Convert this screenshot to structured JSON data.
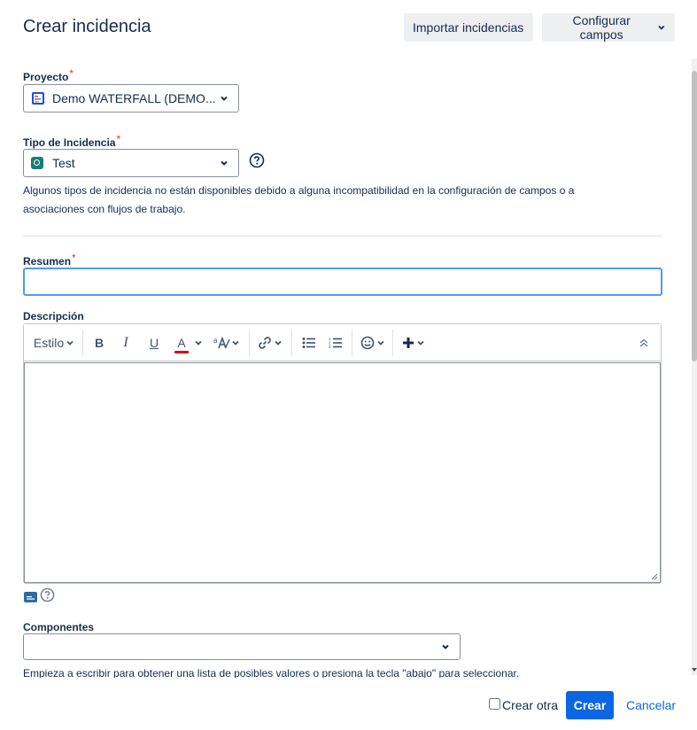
{
  "dialog": {
    "title": "Crear incidencia"
  },
  "header": {
    "import_label": "Importar incidencias",
    "configure_label": "Configurar campos"
  },
  "project": {
    "label": "Proyecto",
    "required_mark": "*",
    "value": "Demo WATERFALL (DEMO..."
  },
  "issue_type": {
    "label": "Tipo de Incidencia",
    "required_mark": "*",
    "value": "Test",
    "note": "Algunos tipos de incidencia no están disponibles debido a alguna incompatibilidad en la configuración de campos o a asociaciones con flujos de trabajo."
  },
  "summary": {
    "label": "Resumen",
    "required_mark": "*",
    "value": ""
  },
  "description": {
    "label": "Descripción",
    "toolbar": {
      "style_label": "Estilo",
      "bold": "B",
      "italic": "I",
      "underline": "U",
      "text_color": "A",
      "text_color_bar": "#e00000"
    }
  },
  "components": {
    "label": "Componentes",
    "hint": "Empieza a escribir para obtener una lista de posibles valores o presiona la tecla \"abajo\" para seleccionar."
  },
  "footer": {
    "create_another_label": "Crear otra",
    "create_label": "Crear",
    "cancel_label": "Cancelar"
  },
  "colors": {
    "primary": "#0c66e4",
    "required": "#de350b",
    "focus": "#4c9aff",
    "test_type": "#1b7a74"
  },
  "icons": [
    "project-icon",
    "test-type-icon",
    "help-icon",
    "chevron-down-icon",
    "bold-icon",
    "italic-icon",
    "underline-icon",
    "text-color-icon",
    "text-size-icon",
    "link-icon",
    "bullet-list-icon",
    "numbered-list-icon",
    "emoji-icon",
    "plus-icon",
    "collapse-toolbar-icon",
    "resize-handle-icon",
    "wiki-markup-icon"
  ]
}
